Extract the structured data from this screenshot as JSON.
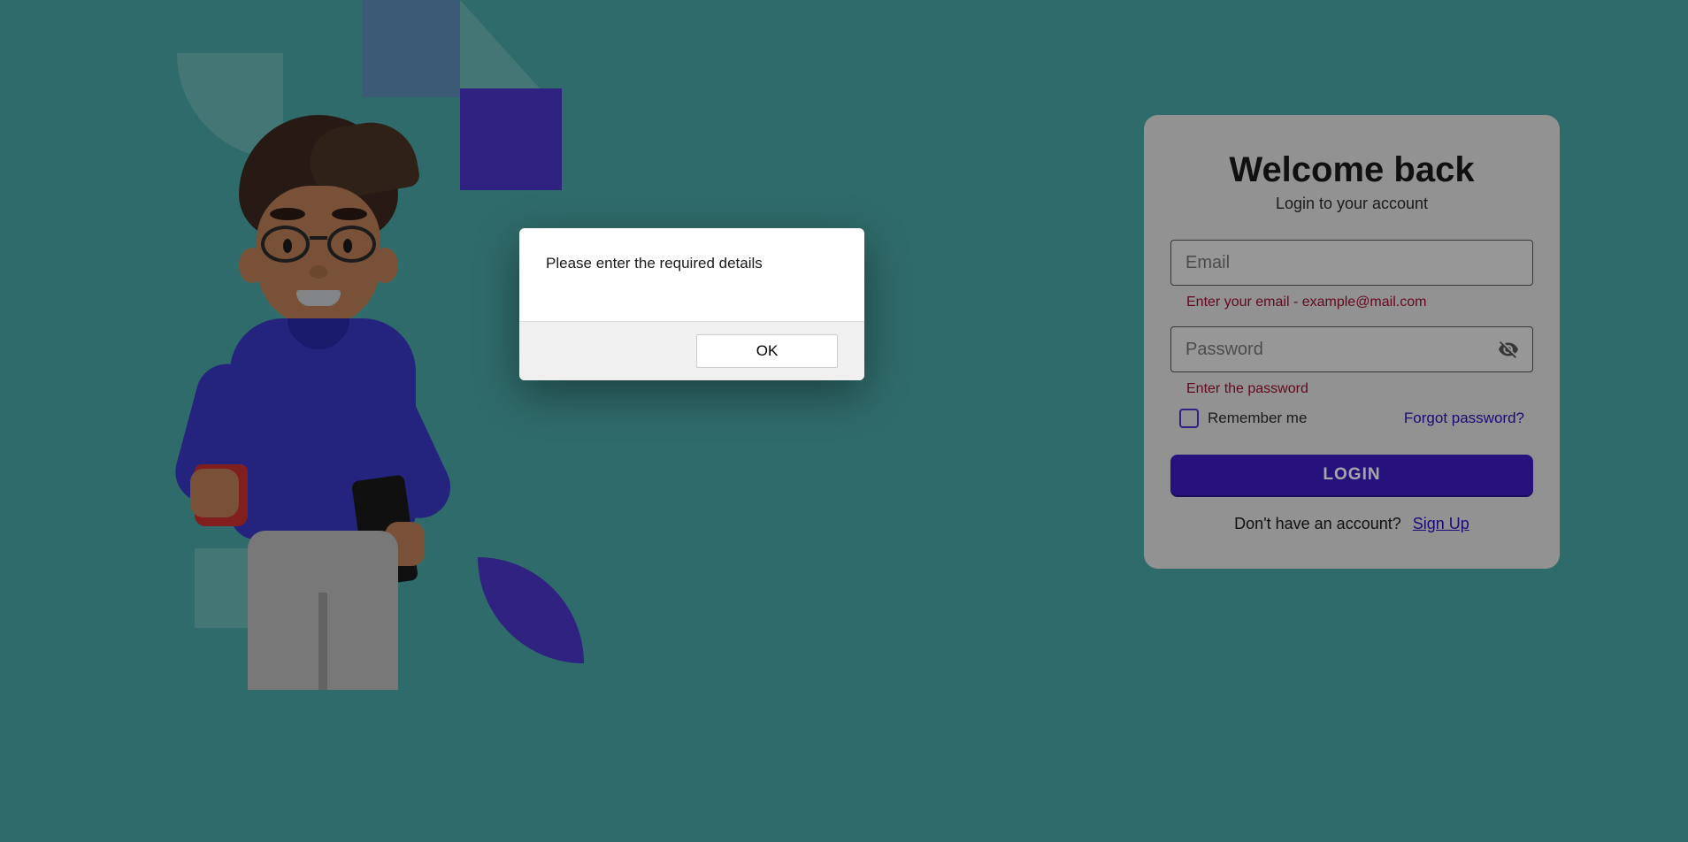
{
  "login": {
    "title": "Welcome back",
    "subtitle": "Login to your account",
    "email_placeholder": "Email",
    "email_error": "Enter your email - example@mail.com",
    "password_placeholder": "Password",
    "password_error": "Enter the password",
    "remember_label": "Remember me",
    "forgot_link": "Forgot password?",
    "login_button": "LOGIN",
    "signup_prompt": "Don't have an account?",
    "signup_link": "Sign Up"
  },
  "modal": {
    "message": "Please enter the required details",
    "ok_button": "OK"
  }
}
